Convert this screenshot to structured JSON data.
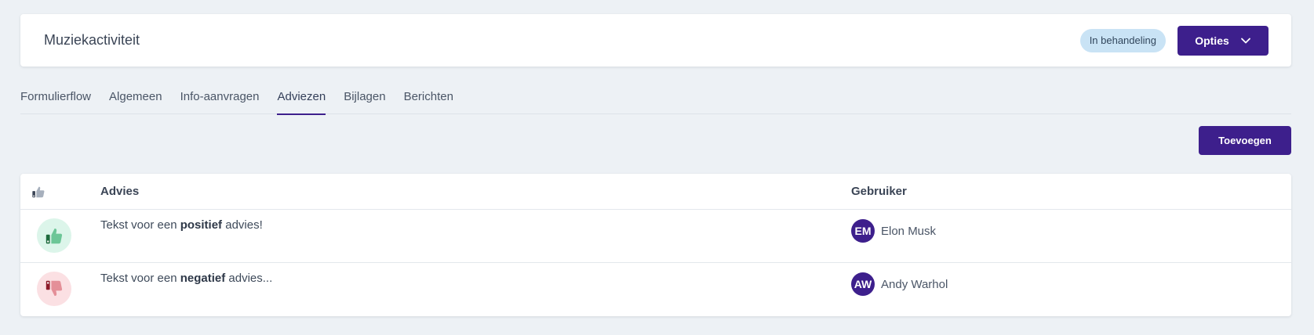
{
  "header": {
    "title": "Muziekactiviteit",
    "status": "In behandeling",
    "options_label": "Opties"
  },
  "tabs": [
    {
      "label": "Formulierflow",
      "active": false
    },
    {
      "label": "Algemeen",
      "active": false
    },
    {
      "label": "Info-aanvragen",
      "active": false
    },
    {
      "label": "Adviezen",
      "active": true
    },
    {
      "label": "Bijlagen",
      "active": false
    },
    {
      "label": "Berichten",
      "active": false
    }
  ],
  "add_label": "Toevoegen",
  "table": {
    "columns": {
      "icon": "thumbs-icon",
      "advice": "Advies",
      "user": "Gebruiker"
    },
    "rows": [
      {
        "sentiment": "positive",
        "icon": "thumbs-up-icon",
        "text_before": "Tekst voor een ",
        "text_bold": "positief",
        "text_after": " advies!",
        "user_initials": "EM",
        "user_name": "Elon Musk"
      },
      {
        "sentiment": "negative",
        "icon": "thumbs-down-icon",
        "text_before": "Tekst voor een ",
        "text_bold": "negatief",
        "text_after": " advies...",
        "user_initials": "AW",
        "user_name": "Andy Warhol"
      }
    ]
  },
  "colors": {
    "primary": "#3d1f8c",
    "badge_bg": "#c9e3f5",
    "positive_bg": "#dcf5ea",
    "positive_fg": "#5cc08f",
    "negative_bg": "#fbe0e3",
    "negative_fg": "#e28a93"
  }
}
